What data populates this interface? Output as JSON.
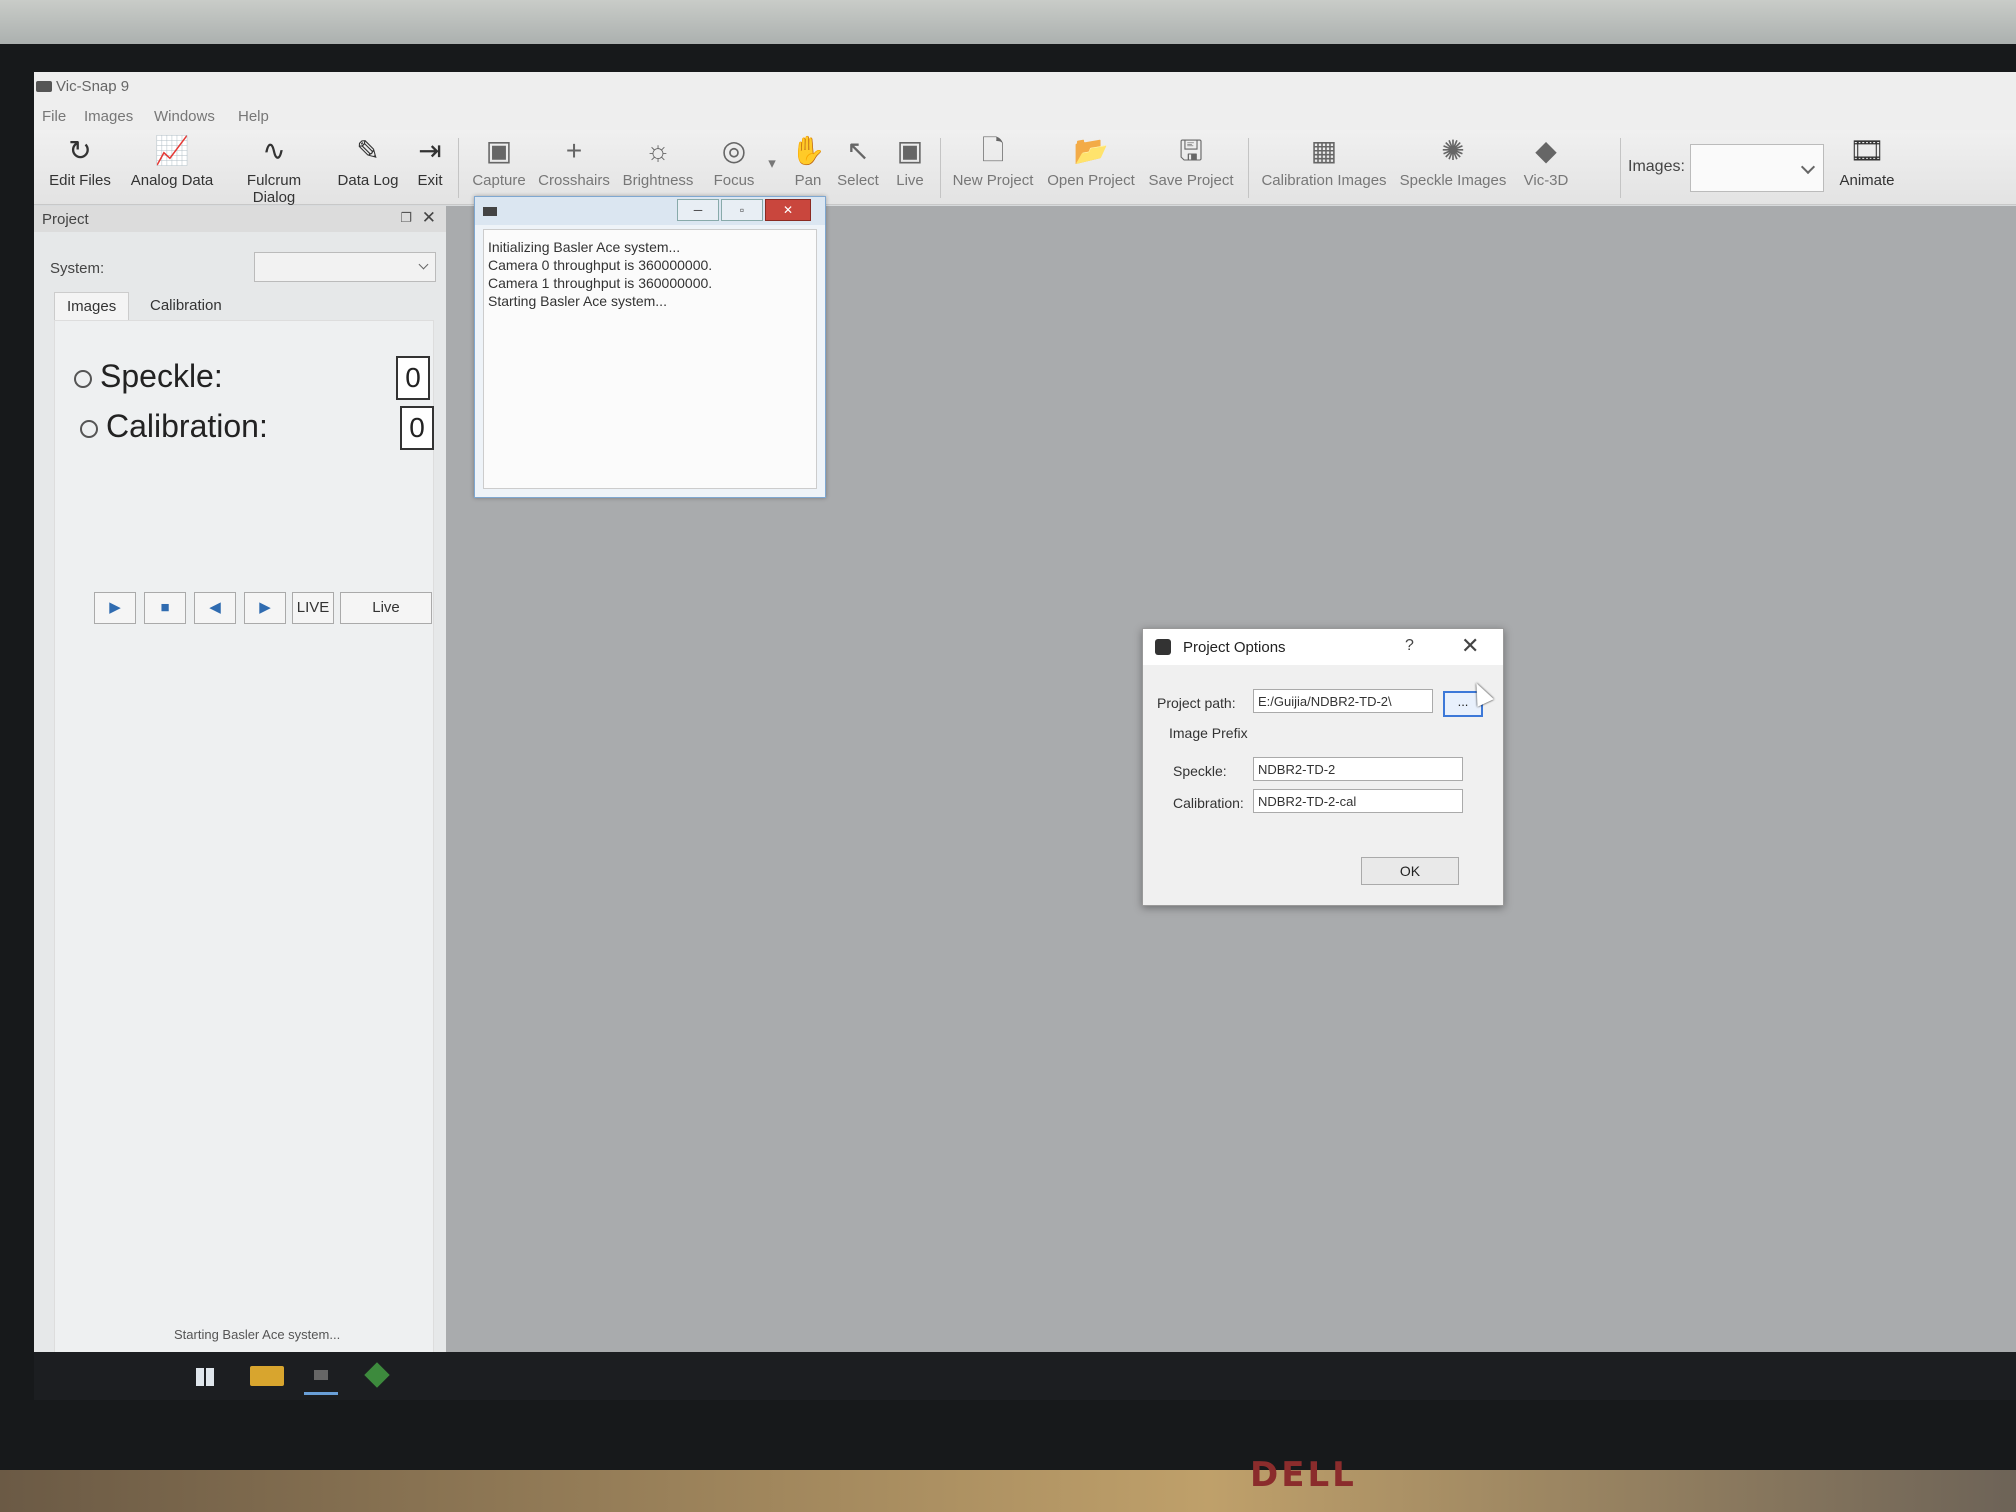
{
  "window": {
    "title": "Vic-Snap 9"
  },
  "menu": [
    "File",
    "Images",
    "Windows",
    "Help"
  ],
  "toolbar": {
    "edit_files": "Edit Files",
    "analog_data": "Analog Data",
    "fulcrum_dialog": "Fulcrum Dialog",
    "data_log": "Data Log",
    "exit": "Exit",
    "capture": "Capture",
    "crosshairs": "Crosshairs",
    "brightness": "Brightness",
    "focus": "Focus",
    "pan": "Pan",
    "select": "Select",
    "live": "Live",
    "new_project": "New Project",
    "open_project": "Open Project",
    "save_project": "Save Project",
    "calibration_images": "Calibration Images",
    "speckle_images": "Speckle Images",
    "vic3d": "Vic-3D",
    "images_label": "Images:",
    "images_value": "",
    "animate": "Animate"
  },
  "project_panel": {
    "title": "Project",
    "system_label": "System:",
    "system_value": "",
    "tabs": [
      "Images",
      "Calibration"
    ],
    "speckle_label": "Speckle:",
    "speckle_count": "0",
    "calibration_label": "Calibration:",
    "calibration_count": "0",
    "live_indicator": "LIVE",
    "live_button": "Live"
  },
  "log_window": {
    "lines": [
      "Initializing Basler Ace system...",
      "Camera 0 throughput is 360000000.",
      "Camera 1 throughput is 360000000.",
      "Starting Basler Ace system..."
    ]
  },
  "dialog": {
    "title": "Project Options",
    "help": "?",
    "project_path_label": "Project path:",
    "project_path_value": "E:/Guijia/NDBR2-TD-2\\",
    "browse_label": "...",
    "image_prefix_label": "Image Prefix",
    "speckle_label": "Speckle:",
    "speckle_value": "NDBR2-TD-2",
    "calibration_label": "Calibration:",
    "calibration_value": "NDBR2-TD-2-cal",
    "ok_label": "OK"
  },
  "status_bar": {
    "text": "Starting Basler Ace system..."
  },
  "monitor": {
    "brand": "DELL"
  },
  "colors": {
    "accent": "#3c78d8",
    "close": "#c9463d"
  }
}
